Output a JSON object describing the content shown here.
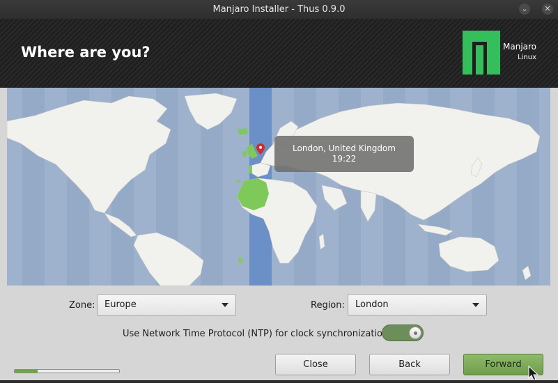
{
  "window": {
    "title": "Manjaro Installer - Thus 0.9.0",
    "minimize_glyph": "⌄",
    "close_glyph": "✕"
  },
  "header": {
    "title": "Where are you?",
    "logo_name": "Manjaro",
    "logo_sub": "Linux"
  },
  "map": {
    "selected_location": "London, United Kingdom",
    "selected_time": "19:22",
    "ocean_color": "#9eb2cd",
    "land_color": "#f1f1ee",
    "highlight_zone_color": "#6b8fc7",
    "selected_region_color": "#7fc95b"
  },
  "zone": {
    "label": "Zone:",
    "value": "Europe"
  },
  "region": {
    "label": "Region:",
    "value": "London"
  },
  "ntp": {
    "label": "Use Network Time Protocol (NTP) for clock synchronization",
    "enabled": true
  },
  "buttons": {
    "close": "Close",
    "back": "Back",
    "forward": "Forward"
  },
  "progress": {
    "fraction": 0.22
  }
}
